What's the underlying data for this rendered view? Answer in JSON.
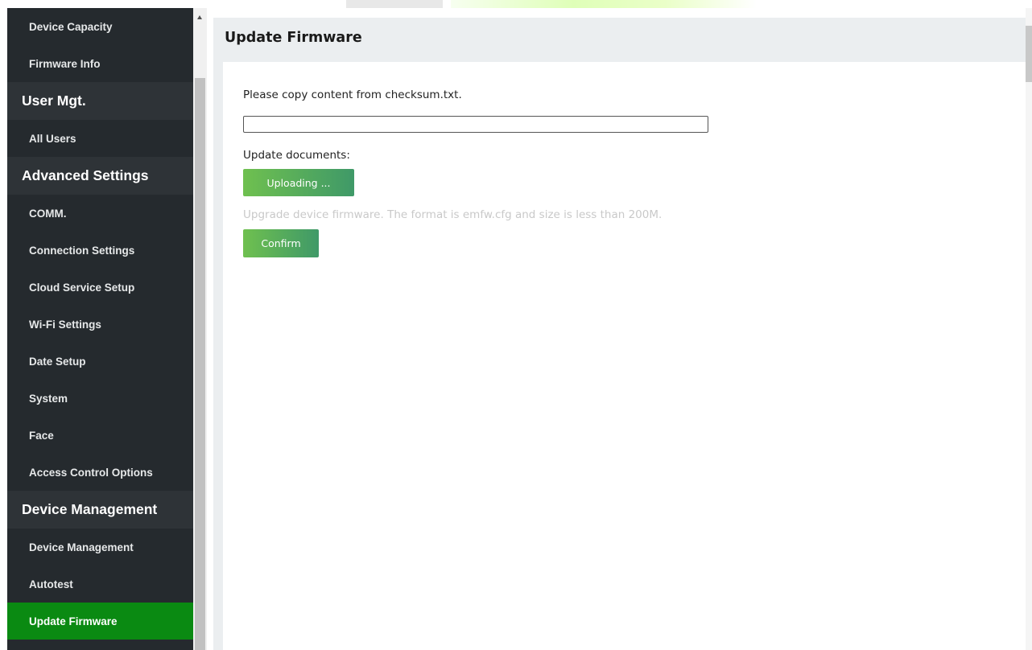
{
  "sidebar": {
    "items": [
      {
        "type": "item",
        "label": "Device Capacity"
      },
      {
        "type": "item",
        "label": "Firmware Info"
      },
      {
        "type": "group",
        "label": "User Mgt."
      },
      {
        "type": "item",
        "label": "All Users"
      },
      {
        "type": "group",
        "label": "Advanced Settings"
      },
      {
        "type": "item",
        "label": "COMM."
      },
      {
        "type": "item",
        "label": "Connection Settings"
      },
      {
        "type": "item",
        "label": "Cloud Service Setup"
      },
      {
        "type": "item",
        "label": "Wi-Fi Settings"
      },
      {
        "type": "item",
        "label": "Date Setup"
      },
      {
        "type": "item",
        "label": "System"
      },
      {
        "type": "item",
        "label": "Face"
      },
      {
        "type": "item",
        "label": "Access Control Options"
      },
      {
        "type": "group",
        "label": "Device Management"
      },
      {
        "type": "item",
        "label": "Device Management"
      },
      {
        "type": "item",
        "label": "Autotest"
      },
      {
        "type": "item",
        "label": "Update Firmware",
        "active": true
      }
    ]
  },
  "main": {
    "title": "Update Firmware",
    "checksum_label": "Please copy content from checksum.txt.",
    "checksum_value": "",
    "documents_label": "Update documents:",
    "upload_button": "Uploading ...",
    "hint": "Upgrade device firmware. The format is emfw.cfg and size is less than 200M.",
    "confirm_button": "Confirm"
  },
  "colors": {
    "sidebar_bg": "#252a2e",
    "group_bg": "#2e3337",
    "active_bg": "#0a8a12",
    "button_green_start": "#6fc04f",
    "button_green_end": "#3f9968",
    "content_bg": "#ebeef0",
    "hint_text": "#c9c9c9"
  },
  "icons": {
    "sidebar_scroll_up": "triangle-up-icon"
  }
}
